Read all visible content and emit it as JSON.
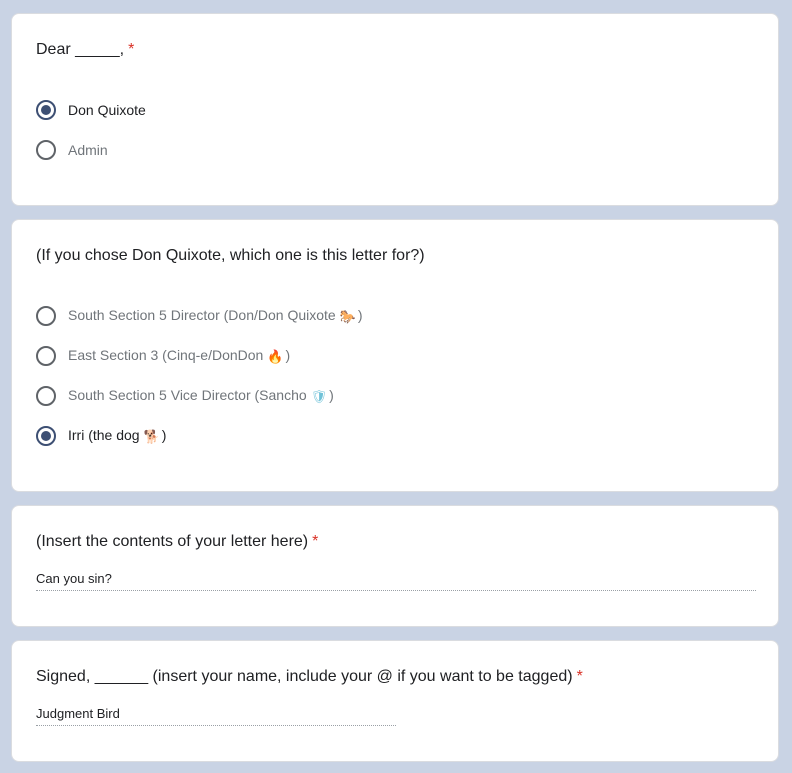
{
  "q1": {
    "title": "Dear _____,",
    "required": "*",
    "options": [
      {
        "label": "Don Quixote",
        "checked": true
      },
      {
        "label": "Admin",
        "checked": false
      }
    ]
  },
  "q2": {
    "title": "(If you chose Don Quixote, which one is this letter for?)",
    "options": [
      {
        "label": "South Section 5 Director (Don/Don Quixote",
        "emoji": "🐎",
        "close": ")",
        "checked": false
      },
      {
        "label": "East Section 3 (Cinq-e/DonDon",
        "emoji": "🔥",
        "close": ")",
        "checked": false
      },
      {
        "label": "South Section 5 Vice Director (Sancho",
        "emoji": "🛡",
        "close": ")",
        "checked": false
      },
      {
        "label": "Irri (the dog",
        "emoji": "🐕",
        "close": ")",
        "checked": true
      }
    ]
  },
  "q3": {
    "title": "(Insert the contents of your letter here)",
    "required": "*",
    "answer": "Can you sin?"
  },
  "q4": {
    "title": "Signed, ______ (insert your name, include your @ if you want to be tagged)",
    "required": "*",
    "answer": "Judgment Bird"
  },
  "colors": {
    "page_background": "#c9d3e4",
    "card_background": "#ffffff",
    "radio_selected": "#3d4f73",
    "required_asterisk": "#d93025"
  },
  "icons": {
    "radio_checked": "radio-checked-icon",
    "radio_unchecked": "radio-unchecked-icon"
  }
}
